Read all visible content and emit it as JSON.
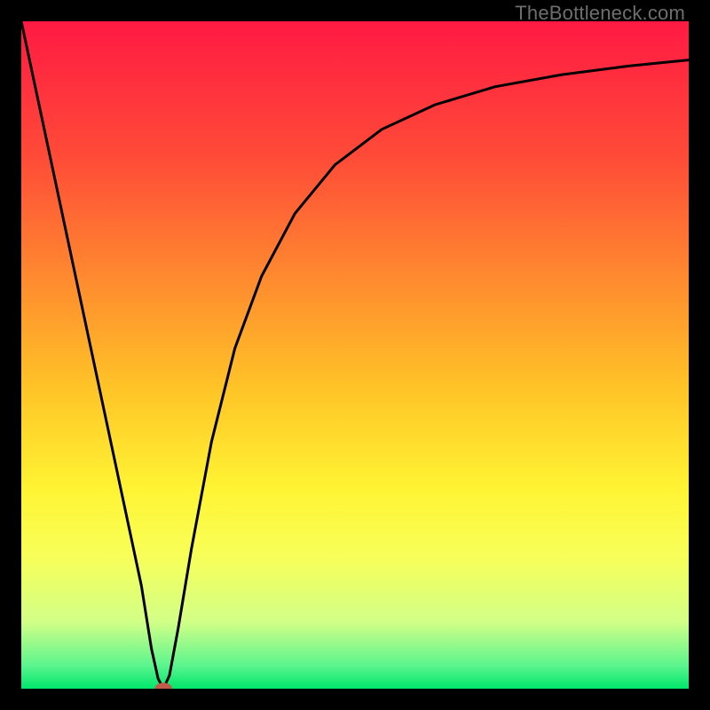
{
  "watermark": "TheBottleneck.com",
  "chart_data": {
    "type": "line",
    "title": "",
    "xlabel": "",
    "ylabel": "",
    "xlim": [
      0,
      1
    ],
    "ylim": [
      0,
      1
    ],
    "background": {
      "type": "vertical-gradient",
      "stops": [
        {
          "offset": 0.0,
          "color": "#ff1a43"
        },
        {
          "offset": 0.2,
          "color": "#ff4a38"
        },
        {
          "offset": 0.4,
          "color": "#ff8f2e"
        },
        {
          "offset": 0.55,
          "color": "#ffc427"
        },
        {
          "offset": 0.7,
          "color": "#fff433"
        },
        {
          "offset": 0.8,
          "color": "#f8ff58"
        },
        {
          "offset": 0.9,
          "color": "#d2ff87"
        },
        {
          "offset": 0.965,
          "color": "#5cf58e"
        },
        {
          "offset": 1.0,
          "color": "#00e66b"
        }
      ]
    },
    "series": [
      {
        "name": "bottleneck-curve",
        "type": "line",
        "color": "#000000",
        "x": [
          0.0,
          0.05,
          0.1,
          0.15,
          0.18,
          0.195,
          0.205,
          0.213,
          0.222,
          0.235,
          0.255,
          0.285,
          0.32,
          0.36,
          0.41,
          0.47,
          0.54,
          0.62,
          0.71,
          0.81,
          0.91,
          1.0
        ],
        "y": [
          1.0,
          0.765,
          0.53,
          0.295,
          0.154,
          0.06,
          0.015,
          0.0,
          0.02,
          0.09,
          0.21,
          0.37,
          0.51,
          0.618,
          0.712,
          0.785,
          0.838,
          0.875,
          0.902,
          0.92,
          0.933,
          0.942
        ]
      }
    ],
    "marker": {
      "name": "optimal-point",
      "x": 0.213,
      "y": 0.0,
      "rx_pct": 0.013,
      "ry_pct": 0.009,
      "color": "#c15a4a"
    }
  }
}
